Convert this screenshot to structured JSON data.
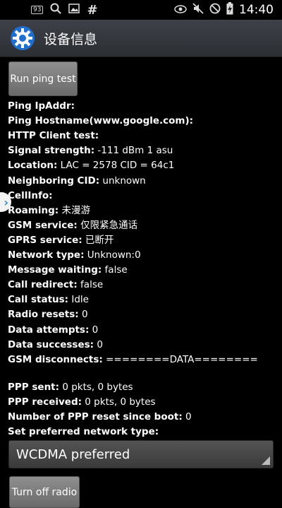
{
  "status_bar": {
    "badge": "93",
    "time": "14:40"
  },
  "title_bar": {
    "title": "设备信息"
  },
  "buttons": {
    "ping_test": "Run ping test",
    "radio": "Turn off radio"
  },
  "info": [
    {
      "label": "Ping IpAddr:",
      "value": ""
    },
    {
      "label": "Ping Hostname(www.google.com):",
      "value": ""
    },
    {
      "label": "HTTP Client test:",
      "value": ""
    },
    {
      "label": "Signal strength:",
      "value": " -111 dBm   1 asu"
    },
    {
      "label": "Location:",
      "value": " LAC = 2578   CID = 64c1"
    },
    {
      "label": "Neighboring CID:",
      "value": " unknown"
    },
    {
      "label": "CellInfo:",
      "value": ""
    },
    {
      "label": "Roaming:",
      "value": " 未漫游"
    },
    {
      "label": "GSM service:",
      "value": " 仅限紧急通话"
    },
    {
      "label": "GPRS service:",
      "value": " 已断开"
    },
    {
      "label": "Network type:",
      "value": " Unknown:0"
    },
    {
      "label": "Message waiting:",
      "value": " false"
    },
    {
      "label": "Call redirect:",
      "value": " false"
    },
    {
      "label": "Call status:",
      "value": " Idle"
    },
    {
      "label": "Radio resets:",
      "value": " 0"
    },
    {
      "label": "Data attempts:",
      "value": " 0"
    },
    {
      "label": "Data successes:",
      "value": " 0"
    },
    {
      "label": "GSM disconnects:",
      "value": " ========DATA========"
    }
  ],
  "ppp": [
    {
      "label": "PPP sent:",
      "value": " 0 pkts, 0 bytes"
    },
    {
      "label": "PPP received:",
      "value": " 0 pkts, 0 bytes"
    },
    {
      "label": "Number of PPP reset since boot:",
      "value": " 0"
    },
    {
      "label": "Set preferred network type:",
      "value": ""
    }
  ],
  "network_type_select": {
    "selected": "WCDMA preferred"
  }
}
